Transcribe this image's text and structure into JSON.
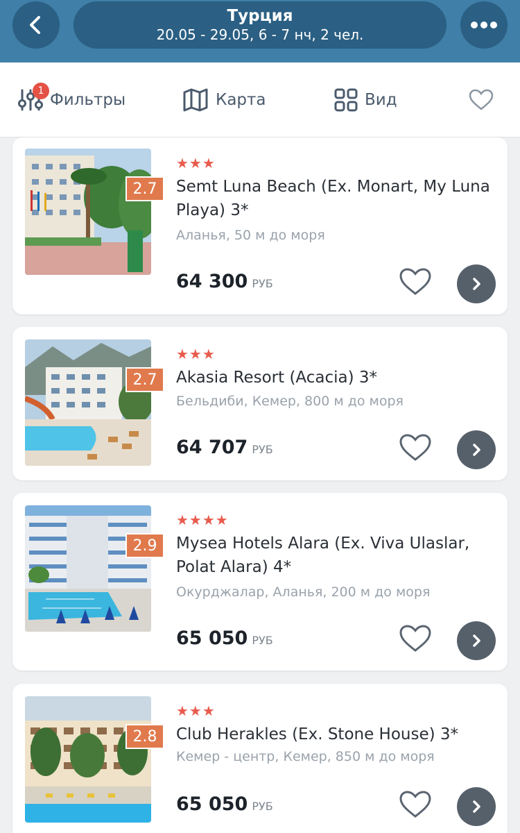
{
  "header": {
    "title": "Турция",
    "subtitle": "20.05 - 29.05, 6 - 7 нч, 2 чел.",
    "back_icon": "chevron-left-icon",
    "more_icon": "more-dots-icon"
  },
  "toolbar": {
    "filters_label": "Фильтры",
    "filters_badge": "1",
    "map_label": "Карта",
    "view_label": "Вид"
  },
  "colors": {
    "header_bg": "#3f7fa8",
    "pill_bg": "#2b5f83",
    "score_bg": "#e07a4d",
    "star": "#e85b4d",
    "badge": "#e45145"
  },
  "hotels": [
    {
      "stars": "★★★",
      "score": "2.7",
      "name": "Semt Luna Beach (Ex. Monart, My Luna Playa) 3*",
      "location": "Аланья, 50 м до моря",
      "price": "64 300",
      "currency": "РУБ"
    },
    {
      "stars": "★★★",
      "score": "2.7",
      "name": "Akasia Resort (Acacia) 3*",
      "location": "Бельдиби, Кемер, 800 м до моря",
      "price": "64 707",
      "currency": "РУБ"
    },
    {
      "stars": "★★★★",
      "score": "2.9",
      "name": "Mysea Hotels Alara (Ex. Viva Ulaslar, Polat Alara) 4*",
      "location": "Окурджалар, Аланья, 200 м до моря",
      "price": "65 050",
      "currency": "РУБ"
    },
    {
      "stars": "★★★",
      "score": "2.8",
      "name": "Club Herakles (Ex. Stone House) 3*",
      "location": "Кемер - центр, Кемер, 850 м до моря",
      "price": "65 050",
      "currency": "РУБ"
    }
  ]
}
